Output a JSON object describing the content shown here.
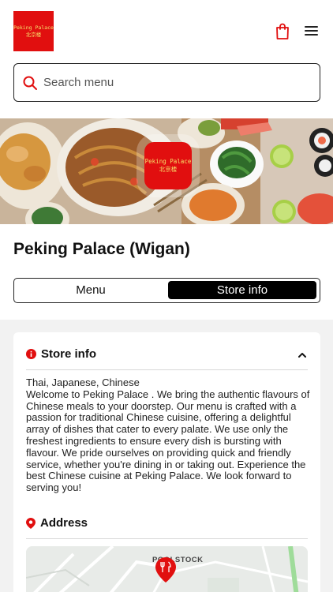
{
  "brand": {
    "logo_line1": "Peking Palace",
    "logo_line2": "北京楼"
  },
  "header": {
    "cart_icon": "shopping-bag-icon",
    "menu_icon": "hamburger-icon"
  },
  "search": {
    "placeholder": "Search menu",
    "value": ""
  },
  "store": {
    "name": "Peking Palace (Wigan)"
  },
  "tabs": [
    {
      "label": "Menu",
      "active": false
    },
    {
      "label": "Store info",
      "active": true
    }
  ],
  "store_info": {
    "title": "Store info",
    "cuisines": "Thai, Japanese, Chinese",
    "description": "Welcome to Peking Palace . We bring the authentic flavours of Chinese meals to your doorstep. Our menu is crafted with a passion for traditional Chinese cuisine, offering a delightful array of dishes that cater to every palate. We use only the freshest ingredients to ensure every dish is bursting with flavour. We pride ourselves on providing quick and friendly service, whether you're dining in or taking out. Experience the best Chinese cuisine at Peking Palace. We look forward to serving you!"
  },
  "address": {
    "title": "Address",
    "map_label": "POOLSTOCK"
  },
  "colors": {
    "accent": "#e10f0f",
    "logo_text": "#f5e06a"
  }
}
